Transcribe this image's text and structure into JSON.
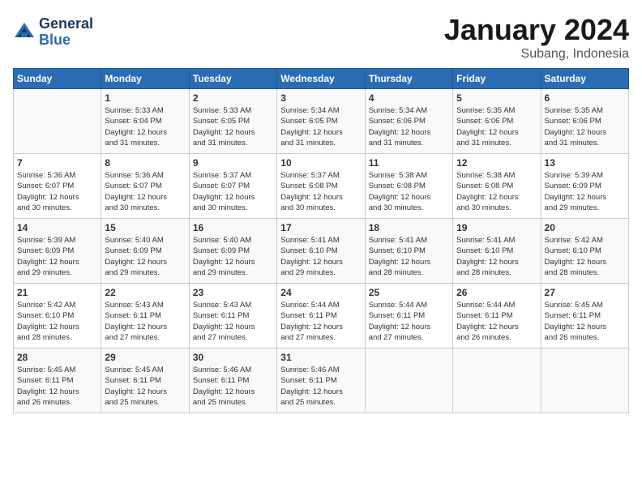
{
  "logo": {
    "line1": "General",
    "line2": "Blue"
  },
  "title": "January 2024",
  "subtitle": "Subang, Indonesia",
  "days_header": [
    "Sunday",
    "Monday",
    "Tuesday",
    "Wednesday",
    "Thursday",
    "Friday",
    "Saturday"
  ],
  "weeks": [
    [
      {
        "day": "",
        "info": ""
      },
      {
        "day": "1",
        "info": "Sunrise: 5:33 AM\nSunset: 6:04 PM\nDaylight: 12 hours\nand 31 minutes."
      },
      {
        "day": "2",
        "info": "Sunrise: 5:33 AM\nSunset: 6:05 PM\nDaylight: 12 hours\nand 31 minutes."
      },
      {
        "day": "3",
        "info": "Sunrise: 5:34 AM\nSunset: 6:05 PM\nDaylight: 12 hours\nand 31 minutes."
      },
      {
        "day": "4",
        "info": "Sunrise: 5:34 AM\nSunset: 6:06 PM\nDaylight: 12 hours\nand 31 minutes."
      },
      {
        "day": "5",
        "info": "Sunrise: 5:35 AM\nSunset: 6:06 PM\nDaylight: 12 hours\nand 31 minutes."
      },
      {
        "day": "6",
        "info": "Sunrise: 5:35 AM\nSunset: 6:06 PM\nDaylight: 12 hours\nand 31 minutes."
      }
    ],
    [
      {
        "day": "7",
        "info": "Sunrise: 5:36 AM\nSunset: 6:07 PM\nDaylight: 12 hours\nand 30 minutes."
      },
      {
        "day": "8",
        "info": "Sunrise: 5:36 AM\nSunset: 6:07 PM\nDaylight: 12 hours\nand 30 minutes."
      },
      {
        "day": "9",
        "info": "Sunrise: 5:37 AM\nSunset: 6:07 PM\nDaylight: 12 hours\nand 30 minutes."
      },
      {
        "day": "10",
        "info": "Sunrise: 5:37 AM\nSunset: 6:08 PM\nDaylight: 12 hours\nand 30 minutes."
      },
      {
        "day": "11",
        "info": "Sunrise: 5:38 AM\nSunset: 6:08 PM\nDaylight: 12 hours\nand 30 minutes."
      },
      {
        "day": "12",
        "info": "Sunrise: 5:38 AM\nSunset: 6:08 PM\nDaylight: 12 hours\nand 30 minutes."
      },
      {
        "day": "13",
        "info": "Sunrise: 5:39 AM\nSunset: 6:09 PM\nDaylight: 12 hours\nand 29 minutes."
      }
    ],
    [
      {
        "day": "14",
        "info": "Sunrise: 5:39 AM\nSunset: 6:09 PM\nDaylight: 12 hours\nand 29 minutes."
      },
      {
        "day": "15",
        "info": "Sunrise: 5:40 AM\nSunset: 6:09 PM\nDaylight: 12 hours\nand 29 minutes."
      },
      {
        "day": "16",
        "info": "Sunrise: 5:40 AM\nSunset: 6:09 PM\nDaylight: 12 hours\nand 29 minutes."
      },
      {
        "day": "17",
        "info": "Sunrise: 5:41 AM\nSunset: 6:10 PM\nDaylight: 12 hours\nand 29 minutes."
      },
      {
        "day": "18",
        "info": "Sunrise: 5:41 AM\nSunset: 6:10 PM\nDaylight: 12 hours\nand 28 minutes."
      },
      {
        "day": "19",
        "info": "Sunrise: 5:41 AM\nSunset: 6:10 PM\nDaylight: 12 hours\nand 28 minutes."
      },
      {
        "day": "20",
        "info": "Sunrise: 5:42 AM\nSunset: 6:10 PM\nDaylight: 12 hours\nand 28 minutes."
      }
    ],
    [
      {
        "day": "21",
        "info": "Sunrise: 5:42 AM\nSunset: 6:10 PM\nDaylight: 12 hours\nand 28 minutes."
      },
      {
        "day": "22",
        "info": "Sunrise: 5:43 AM\nSunset: 6:11 PM\nDaylight: 12 hours\nand 27 minutes."
      },
      {
        "day": "23",
        "info": "Sunrise: 5:43 AM\nSunset: 6:11 PM\nDaylight: 12 hours\nand 27 minutes."
      },
      {
        "day": "24",
        "info": "Sunrise: 5:44 AM\nSunset: 6:11 PM\nDaylight: 12 hours\nand 27 minutes."
      },
      {
        "day": "25",
        "info": "Sunrise: 5:44 AM\nSunset: 6:11 PM\nDaylight: 12 hours\nand 27 minutes."
      },
      {
        "day": "26",
        "info": "Sunrise: 5:44 AM\nSunset: 6:11 PM\nDaylight: 12 hours\nand 26 minutes."
      },
      {
        "day": "27",
        "info": "Sunrise: 5:45 AM\nSunset: 6:11 PM\nDaylight: 12 hours\nand 26 minutes."
      }
    ],
    [
      {
        "day": "28",
        "info": "Sunrise: 5:45 AM\nSunset: 6:11 PM\nDaylight: 12 hours\nand 26 minutes."
      },
      {
        "day": "29",
        "info": "Sunrise: 5:45 AM\nSunset: 6:11 PM\nDaylight: 12 hours\nand 25 minutes."
      },
      {
        "day": "30",
        "info": "Sunrise: 5:46 AM\nSunset: 6:11 PM\nDaylight: 12 hours\nand 25 minutes."
      },
      {
        "day": "31",
        "info": "Sunrise: 5:46 AM\nSunset: 6:11 PM\nDaylight: 12 hours\nand 25 minutes."
      },
      {
        "day": "",
        "info": ""
      },
      {
        "day": "",
        "info": ""
      },
      {
        "day": "",
        "info": ""
      }
    ]
  ]
}
